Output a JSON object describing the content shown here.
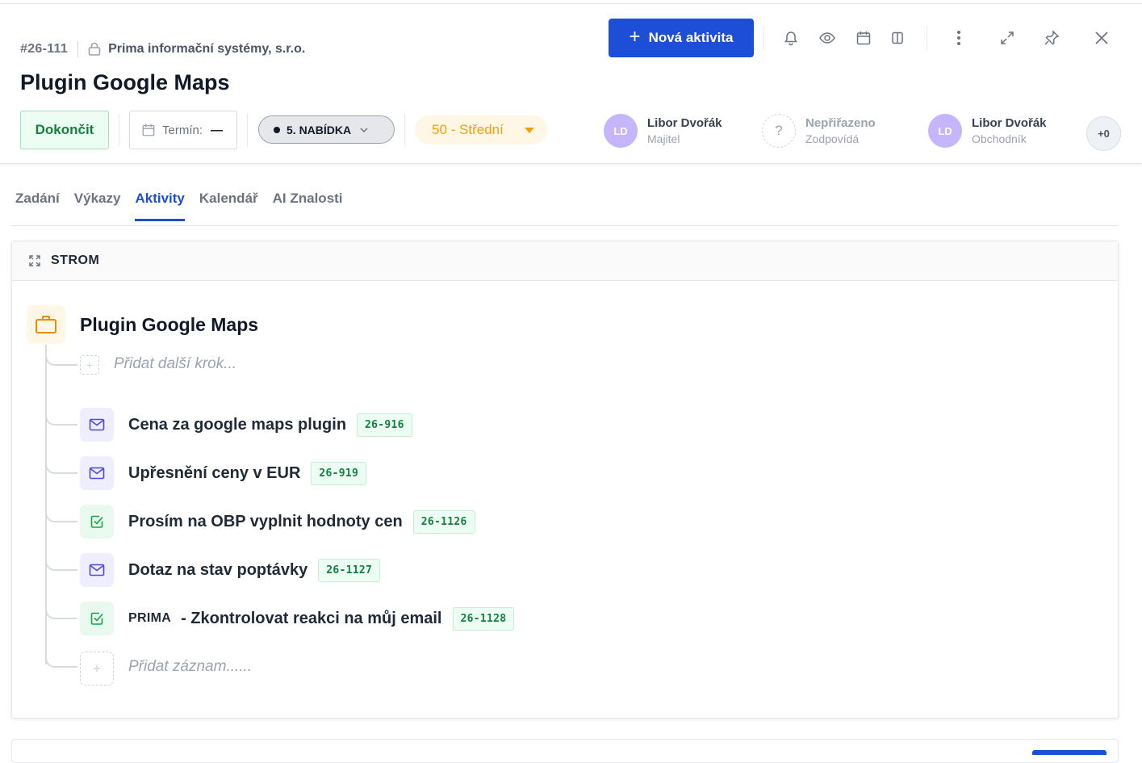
{
  "header": {
    "record_number": "#26-111",
    "company": "Prima informační systémy, s.r.o.",
    "title": "Plugin Google Maps",
    "new_activity_label": "Nová aktivita",
    "finish_label": "Dokončit",
    "term_label": "Termín:",
    "term_value": "—",
    "stage_label": "5. NABÍDKA",
    "priority_label": "50 - Střední",
    "people": [
      {
        "initials": "LD",
        "name": "Libor Dvořák",
        "role": "Majitel"
      },
      {
        "initials": "?",
        "name": "Nepřiřazeno",
        "role": "Zodpovídá"
      },
      {
        "initials": "LD",
        "name": "Libor Dvořák",
        "role": "Obchodník"
      }
    ],
    "extra_count": "+0",
    "icons": [
      "bell-icon",
      "eye-icon",
      "calendar-icon",
      "columns-icon",
      "more-vertical-icon",
      "expand-icon",
      "pin-icon",
      "close-icon"
    ]
  },
  "tabs": [
    {
      "label": "Zadání"
    },
    {
      "label": "Výkazy"
    },
    {
      "label": "Aktivity",
      "active": true
    },
    {
      "label": "Kalendář"
    },
    {
      "label": "AI Znalosti"
    }
  ],
  "tree": {
    "header_label": "STROM",
    "root_title": "Plugin Google Maps",
    "add_step_placeholder": "Přidat další krok...",
    "items": [
      {
        "type": "mail",
        "prefix": "",
        "title": "Cena za google maps plugin",
        "badge": "26-916"
      },
      {
        "type": "mail",
        "prefix": "",
        "title": "Upřesnění ceny v EUR",
        "badge": "26-919"
      },
      {
        "type": "task",
        "prefix": "",
        "title": "Prosím na OBP vyplnit hodnoty cen",
        "badge": "26-1126"
      },
      {
        "type": "mail",
        "prefix": "",
        "title": "Dotaz na stav poptávky",
        "badge": "26-1127"
      },
      {
        "type": "task",
        "prefix": "PRIMA",
        "title": "- Zkontrolovat reakci na můj email",
        "badge": "26-1128"
      }
    ],
    "add_record_placeholder": "Přidat záznam......"
  },
  "colors": {
    "accent": "#1d4ed8",
    "success": "#15803d",
    "priority": "#f59e0b",
    "avatar": "#c4b5fd"
  }
}
